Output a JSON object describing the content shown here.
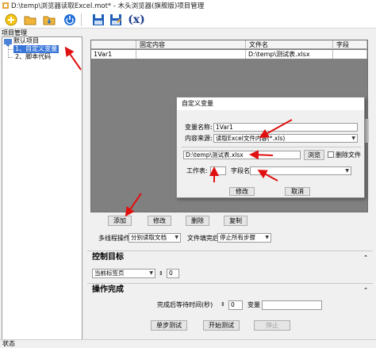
{
  "window": {
    "title": "D:\\temp\\浏览器读取Excel.mot* - 木头浏览器(旗舰版)项目管理"
  },
  "toolbar": {
    "icons": [
      "new-icon",
      "open-folder-icon",
      "import-folder-icon",
      "power-icon",
      "save-icon",
      "save-as-icon",
      "variable-icon"
    ],
    "variable_label": "(x)"
  },
  "left_panel": {
    "header": "项目管理",
    "tree": {
      "root": "默认项目",
      "items": [
        "1、自定义变量",
        "2、脚本代码"
      ]
    }
  },
  "grid": {
    "columns": [
      "",
      "固定内容",
      "文件名",
      "字段"
    ],
    "rows": [
      {
        "name": "1Var1",
        "fixed": "",
        "file": "D:\\temp\\测试表.xlsx",
        "field": ""
      }
    ]
  },
  "dialog": {
    "title": "自定义变量",
    "var_name_label": "变量名称:",
    "var_name_value": "1Var1",
    "source_label": "内容来源:",
    "source_value": "读取Excel文件内容(*.xls)",
    "file_path": "D:\\temp\\测试表.xlsx",
    "browse_label": "浏览",
    "delete_file_label": "删除文件",
    "sheet_label": "工作表:",
    "sheet_value": "1",
    "field_label": "字段名:",
    "field_value": "",
    "ok_label": "修改",
    "cancel_label": "取消"
  },
  "actions": {
    "add": "添加",
    "modify": "修改",
    "delete": "删除",
    "copy": "复制"
  },
  "options": {
    "multithread_label": "多线程操作",
    "multithread_value": "分别读取文档",
    "after_file_label": "文件填完后",
    "after_file_value": "停止所有步骤"
  },
  "control": {
    "title": "控制目标",
    "target_value": "当前标签页",
    "index_value": "0"
  },
  "complete": {
    "title": "操作完成",
    "wait_label": "完成后等待时间(秒)",
    "wait_value": "0",
    "var_label": "变量",
    "var_value": ""
  },
  "bottom": {
    "step": "单步测试",
    "start": "开始测试",
    "stop": "停止"
  },
  "status": {
    "text": "状态"
  },
  "colors": {
    "selection": "#3875d7",
    "grid_bg": "#808080",
    "arrow": "#e01010"
  }
}
